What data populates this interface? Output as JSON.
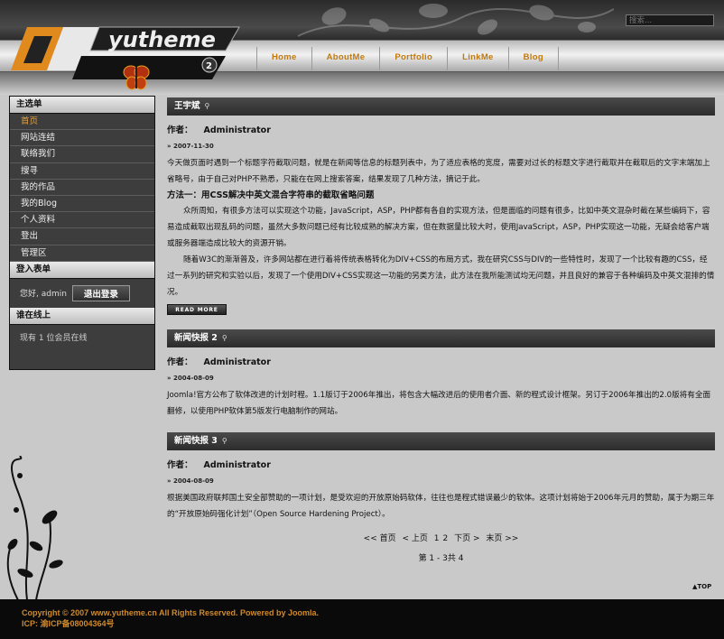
{
  "header": {
    "search_placeholder": "搜索...",
    "logo_text": "yutheme",
    "logo_badge": "2"
  },
  "nav": [
    "Home",
    "AboutMe",
    "Portfolio",
    "LinkMe",
    "Blog"
  ],
  "sidebar": {
    "main_menu_title": "主选单",
    "menu": [
      "首页",
      "网站连结",
      "联络我们",
      "搜寻",
      "我的作品",
      "我的Blog",
      "个人资料",
      "登出",
      "管理区"
    ],
    "login_title": "登入表单",
    "greeting": "您好, admin",
    "logout_label": "退出登录",
    "online_title": "谁在线上",
    "online_text": "现有  1 位会员在线"
  },
  "articles": [
    {
      "title": "王宇斌",
      "author_label": "作者：",
      "author": "Administrator",
      "date": "2007-11-30",
      "p1": "今天做页面时遇到一个标题字符截取问题，就是在新闻等信息的标题列表中，为了适应表格的宽度，需要对过长的标题文字进行截取并在截取后的文字末端加上省略号，由于自己对PHP不熟悉，只能在在网上搜索答案，结果发现了几种方法，摘记于此。",
      "subhead": "方法一：用CSS解决中英文混合字符串的截取省略问题",
      "p2": "众所周知，有很多方法可以实现这个功能，JavaScript，ASP，PHP都有各自的实现方法，但是面临的问题有很多，比如中英文混杂时截在某些编码下，容易造成截取出现乱码的问题，虽然大多数问题已经有比较成熟的解决方案，但在数据量比较大时，使用JavaScript，ASP，PHP实现这一功能，无疑会给客户端或服务器端造成比较大的资源开销。",
      "p3": "随着W3C的渐渐普及，许多网站都在进行着将传统表格转化为DIV+CSS的布局方式，我在研究CSS与DIV的一些特性时，发现了一个比较有趣的CSS，经过一系列的研究和实验以后，发现了一个使用DIV+CSS实现这一功能的另类方法，此方法在我所能测试均无问题，并且良好的兼容于各种编码及中英文混排的情况。",
      "readmore": "READ MORE"
    },
    {
      "title": "新闻快报  2",
      "author_label": "作者：",
      "author": "Administrator",
      "date": "2004-08-09",
      "p1": "Joomla!官方公布了软体改进的计划时程。1.1版订于2006年推出，将包含大幅改进后的使用者介面、新的程式设计框架。另订于2006年推出的2.0版将有全面翻修，以使用PHP软体第5版发行电脑制作的网站。"
    },
    {
      "title": "新闻快报  3",
      "author_label": "作者：",
      "author": "Administrator",
      "date": "2004-08-09",
      "p1": "根据美国政府联邦国土安全部赞助的一项计划，是受欢迎的开放原始码软体，往往也是程式错误最少的软体。这项计划将始于2006年元月的赞助，属于为期三年的“开放原始码强化计划”（Open Source Hardening Project）。"
    }
  ],
  "pagination": {
    "first": "<< 首页",
    "prev": "< 上页",
    "p1": "1",
    "p2": "2",
    "next": "下页 >",
    "last": "末页 >>",
    "count": "第  1 - 3共  4"
  },
  "totop": "▲TOP",
  "footer": {
    "copyright": "Copyright © 2007 www.yutheme.cn All Rights Reserved. Powered by Joomla.",
    "icp": "ICP: 渝ICP备08004364号"
  },
  "colors": {
    "accent": "#c07a10",
    "sidebar_bg": "#3d3d3d",
    "footer_text": "#d08a2a"
  }
}
